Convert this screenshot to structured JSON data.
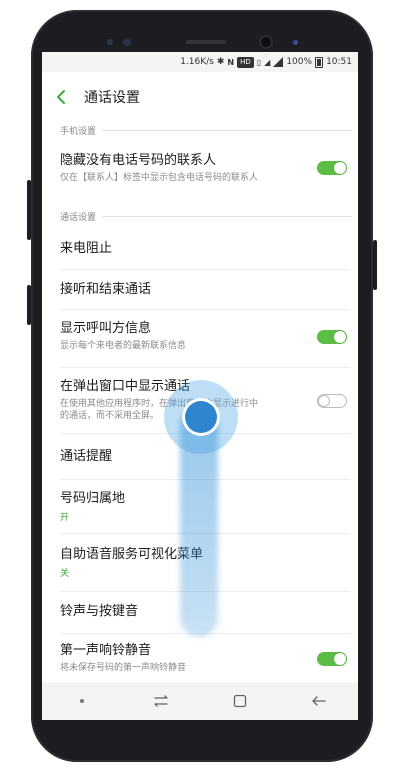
{
  "status_bar": {
    "net_speed": "1.16K/s",
    "hd": "HD",
    "battery": "100%",
    "time": "10:51"
  },
  "app_bar": {
    "title": "通话设置",
    "back_icon": "chevron-left-icon"
  },
  "sections": {
    "phone": "手机设置",
    "call": "通话设置"
  },
  "settings": {
    "hide_contacts": {
      "label": "隐藏没有电话号码的联系人",
      "desc": "仅在【联系人】标签中显示包含电话号码的联系人",
      "toggle": true
    },
    "call_block": {
      "label": "来电阻止"
    },
    "answer_end": {
      "label": "接听和结束通话"
    },
    "caller_info": {
      "label": "显示呼叫方信息",
      "desc": "显示每个来电者的最新联系信息",
      "toggle": true
    },
    "popup_call": {
      "label": "在弹出窗口中显示通话",
      "desc_line1": "在使用其他应用程序时，在弹出窗口中显示进行中",
      "desc_line2": "的通话，而不采用全屏。",
      "toggle": false
    },
    "call_alert": {
      "label": "通话提醒"
    },
    "location": {
      "label": "号码归属地",
      "value": "开"
    },
    "ivr_menu": {
      "label": "自助语音服务可视化菜单",
      "value": "关"
    },
    "ringtone": {
      "label": "铃声与按键音"
    },
    "first_ring_mute": {
      "label": "第一声响铃静音",
      "desc": "将未保存号码的第一声响铃静音",
      "toggle": true
    }
  },
  "nav_bar": {
    "icons": [
      "dot-icon",
      "recent-apps-icon",
      "home-icon",
      "back-arrow-icon"
    ]
  },
  "colors": {
    "accent": "#5cbd44",
    "value_green": "#3fa83b",
    "touch_blue": "#2f86cf"
  }
}
